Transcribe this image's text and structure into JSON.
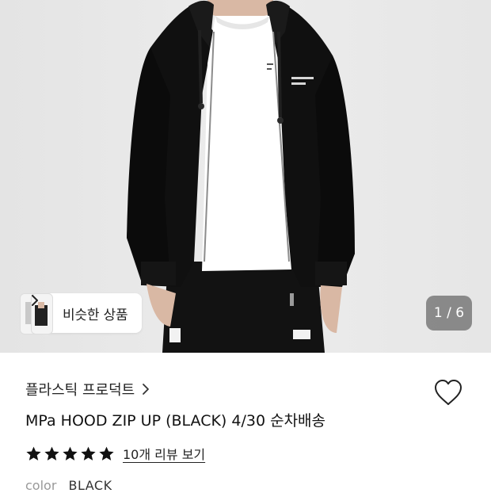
{
  "product_image": {
    "alt": "product-photo",
    "counter": "1 / 6",
    "similar_button": "비슷한 상품"
  },
  "product": {
    "brand": "플라스틱 프로덕트",
    "title": "MPa HOOD ZIP UP (BLACK) 4/30 순차배송",
    "rating_stars": 5,
    "review_link": "10개 리뷰 보기",
    "color_label": "color",
    "color_value": "BLACK"
  },
  "colors": {
    "background": "#ffffff",
    "image_bg": "#e9e9e9",
    "hoodie": "#0f0f0f",
    "counter_bg": "#3c3c3c"
  },
  "icons": {
    "wishlist": "heart-outline-icon",
    "brand_chevron": "chevron-right-icon",
    "similar_chevron": "chevron-right-icon",
    "star": "star-filled-icon"
  }
}
